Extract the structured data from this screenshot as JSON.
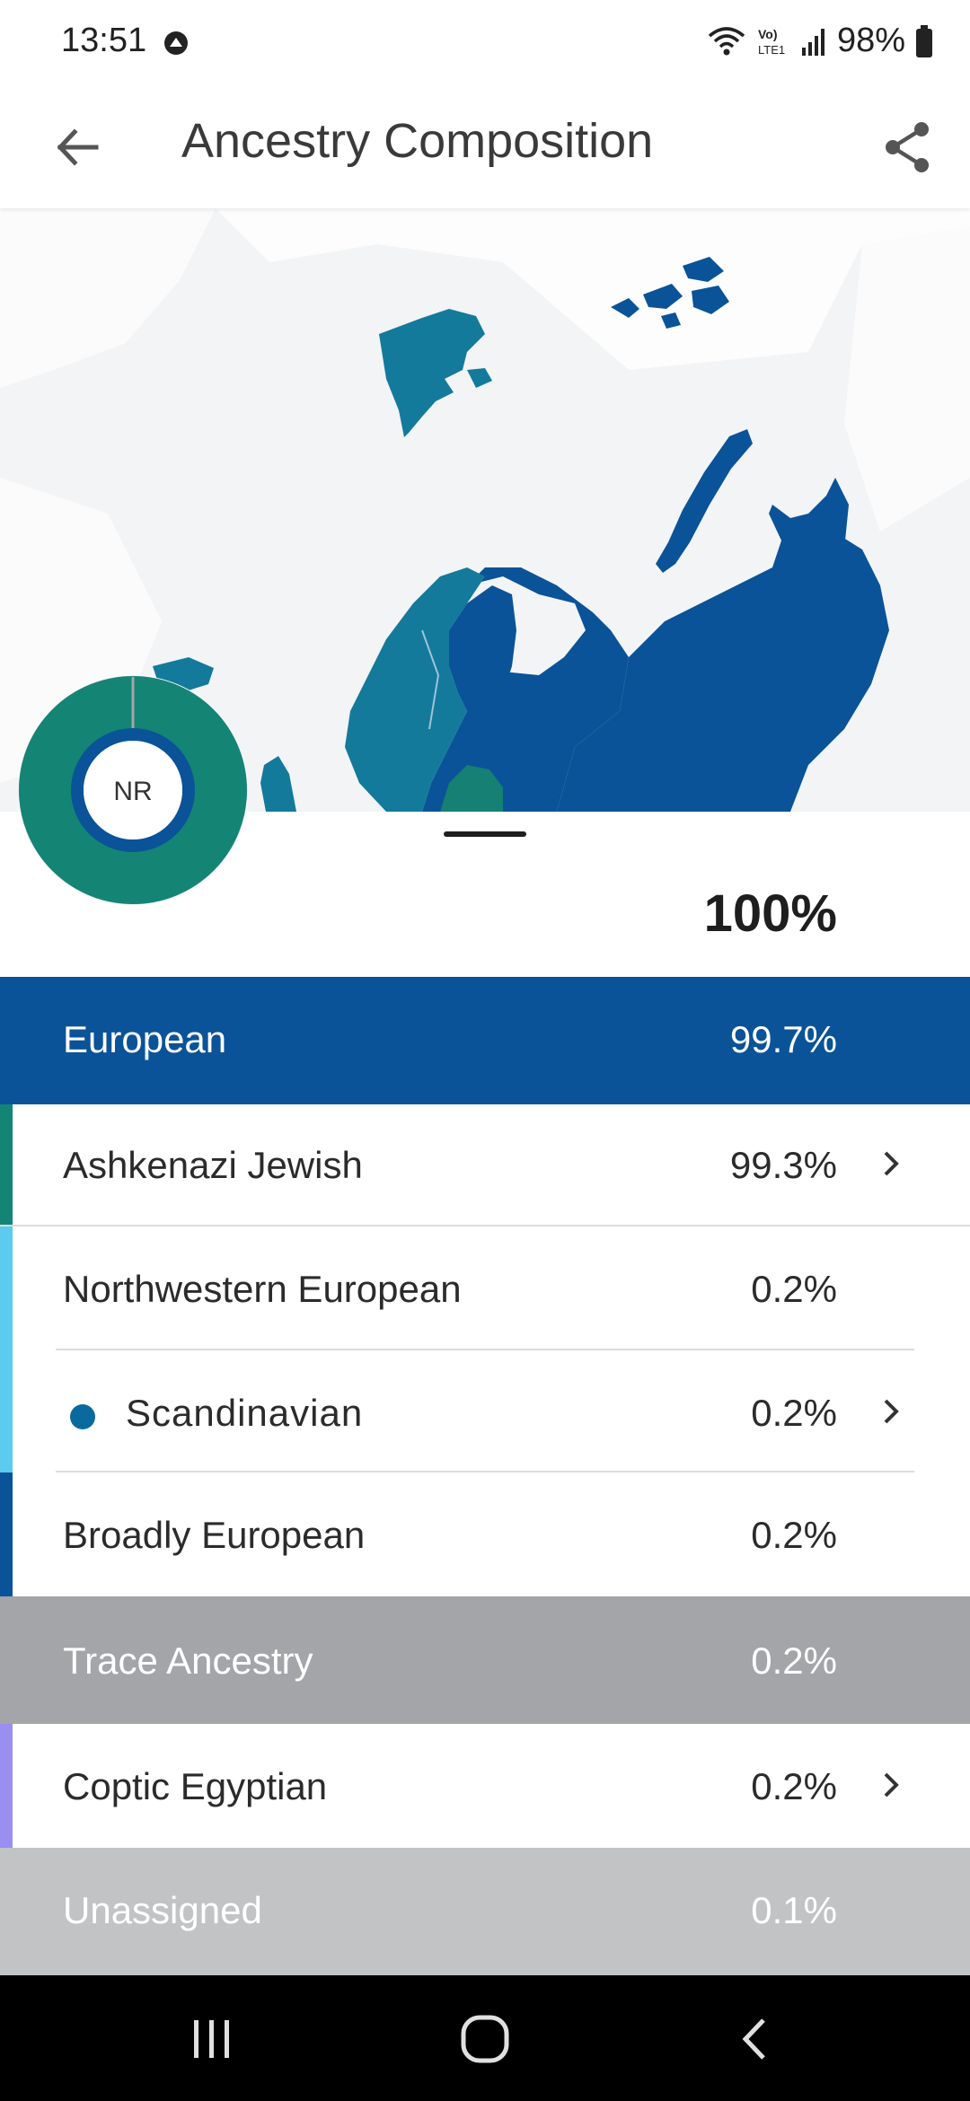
{
  "status_bar": {
    "time": "13:51",
    "battery": "98%",
    "network": "VoLTE1"
  },
  "header": {
    "title": "Ancestry Composition"
  },
  "map": {
    "region": "Northern Europe and Russia",
    "colors": {
      "sea": "#f2f4f6",
      "land": "#0a5398",
      "scandinavia": "#137a9c",
      "baltic": "#158073"
    }
  },
  "donut": {
    "initials": "NR",
    "segments": [
      {
        "name": "Ashkenazi Jewish",
        "fraction": 0.993,
        "color": "#148475"
      },
      {
        "name": "Other",
        "fraction": 0.007,
        "color": "#a3a5a8"
      }
    ],
    "inner_ring_color": "#0a5398"
  },
  "summary": {
    "total": "100%"
  },
  "rows": {
    "european": {
      "label": "European",
      "value": "99.7%",
      "color": "#0a5398"
    },
    "ashkenazi": {
      "label": "Ashkenazi Jewish",
      "value": "99.3%",
      "color": "#148475"
    },
    "northwestern": {
      "label": "Northwestern European",
      "value": "0.2%",
      "color": "#5ccbee"
    },
    "scandinavian": {
      "label": "Scandinavian",
      "value": "0.2%",
      "color": "#0a6a9e"
    },
    "broadly": {
      "label": "Broadly European",
      "value": "0.2%",
      "color": "#0a5398"
    },
    "trace": {
      "label": "Trace Ancestry",
      "value": "0.2%",
      "color": "#a3a5a8"
    },
    "coptic": {
      "label": "Coptic Egyptian",
      "value": "0.2%",
      "color": "#9a8ef0"
    },
    "unassigned": {
      "label": "Unassigned",
      "value": "0.1%",
      "color": "#c2c3c5"
    }
  }
}
